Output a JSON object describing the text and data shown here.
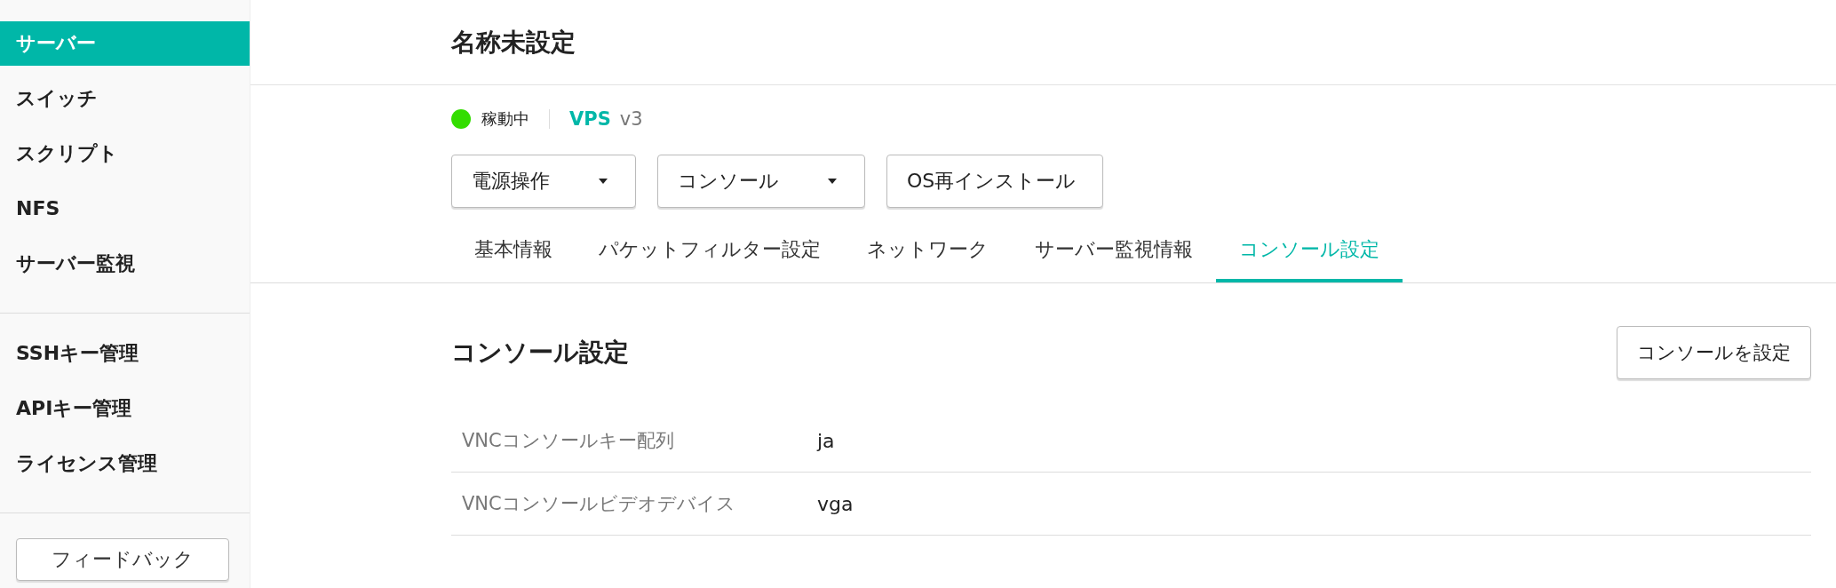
{
  "sidebar": {
    "groups": [
      {
        "items": [
          {
            "label": "サーバー",
            "selected": true
          },
          {
            "label": "スイッチ",
            "selected": false
          },
          {
            "label": "スクリプト",
            "selected": false
          },
          {
            "label": "NFS",
            "selected": false
          },
          {
            "label": "サーバー監視",
            "selected": false
          }
        ]
      },
      {
        "items": [
          {
            "label": "SSHキー管理",
            "selected": false
          },
          {
            "label": "APIキー管理",
            "selected": false
          },
          {
            "label": "ライセンス管理",
            "selected": false
          }
        ]
      }
    ],
    "feedback_button": "フィードバック"
  },
  "header": {
    "title": "名称未設定"
  },
  "status": {
    "label": "稼動中",
    "color": "#33dd00",
    "plan": "VPS",
    "version": "v3"
  },
  "actions": [
    {
      "label": "電源操作",
      "dropdown": true
    },
    {
      "label": "コンソール",
      "dropdown": true
    },
    {
      "label": "OS再インストール",
      "dropdown": false
    }
  ],
  "tabs": [
    {
      "label": "基本情報",
      "selected": false
    },
    {
      "label": "パケットフィルター設定",
      "selected": false
    },
    {
      "label": "ネットワーク",
      "selected": false
    },
    {
      "label": "サーバー監視情報",
      "selected": false
    },
    {
      "label": "コンソール設定",
      "selected": true
    }
  ],
  "section": {
    "title": "コンソール設定",
    "button": "コンソールを設定",
    "rows": [
      {
        "label": "VNCコンソールキー配列",
        "value": "ja"
      },
      {
        "label": "VNCコンソールビデオデバイス",
        "value": "vga"
      }
    ]
  }
}
